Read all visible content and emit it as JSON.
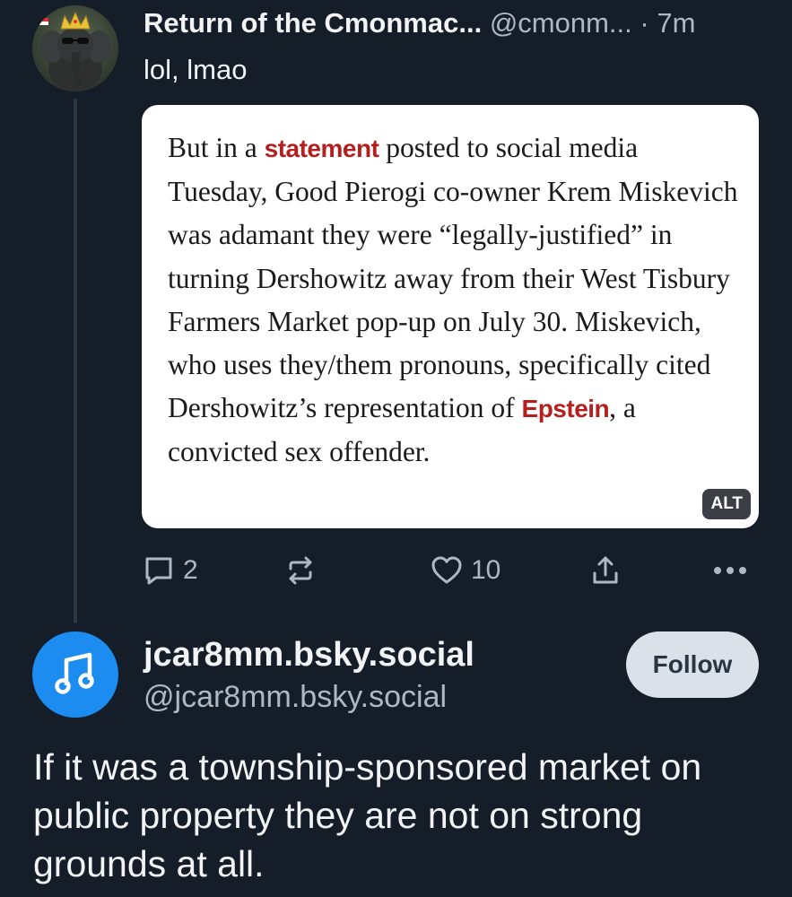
{
  "colors": {
    "background": "#151d28",
    "text_primary": "#f1f3f5",
    "text_secondary": "#aeb8c4",
    "accent_blue": "#1d8cf0",
    "link_red": "#b3201e",
    "follow_button_bg": "#dbe1e8"
  },
  "post1": {
    "display_name": "Return of the Cmonmac...",
    "handle": "@cmonm...",
    "separator": "·",
    "time": "7m",
    "text": "lol, lmao",
    "avatar_icon": "elephant-with-crown-avatar",
    "embed": {
      "seg1": "But in a ",
      "link1": "statement",
      "seg2": " posted to social media Tuesday, Good Pierogi co-owner Krem Miskevich was adamant they were “legally-justified” in turning Dershowitz away from their West Tisbury Farmers Market pop-up on July 30. Miskevich, who uses they/them pronouns, specifically cited Dershowitz’s representation of ",
      "link2": "Epstein",
      "seg3": ", a convicted sex offender.",
      "alt_badge": "ALT"
    },
    "actions": {
      "reply_count": "2",
      "repost_count": "",
      "like_count": "10",
      "icons": [
        "reply-icon",
        "repost-icon",
        "heart-icon",
        "share-icon",
        "more-icon"
      ]
    }
  },
  "post2": {
    "display_name": "jcar8mm.bsky.social",
    "handle": "@jcar8mm.bsky.social",
    "follow_label": "Follow",
    "avatar_icon": "music-note-icon",
    "text": "If it was a township-sponsored market on public property they are not on strong grounds at all."
  }
}
